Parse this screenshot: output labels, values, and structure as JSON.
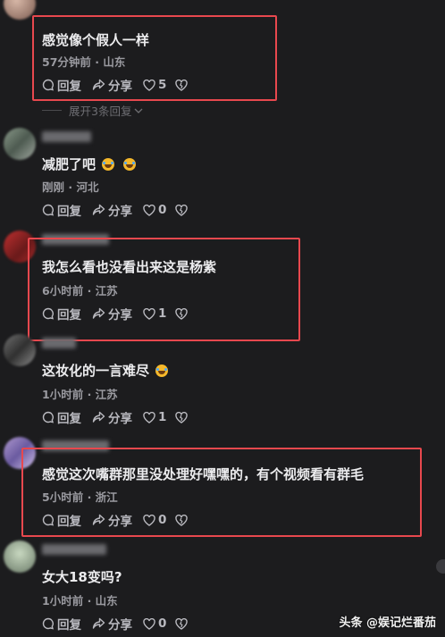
{
  "comments": [
    {
      "text": "感觉像个假人一样",
      "time": "57分钟前",
      "location": "山东",
      "reply": "回复",
      "share": "分享",
      "likes": "5",
      "emojis": 0
    },
    {
      "text": "减肥了吧",
      "time": "刚刚",
      "location": "河北",
      "reply": "回复",
      "share": "分享",
      "likes": "0",
      "emojis": 2
    },
    {
      "text": "我怎么看也没看出来这是杨紫",
      "time": "6小时前",
      "location": "江苏",
      "reply": "回复",
      "share": "分享",
      "likes": "1",
      "emojis": 0
    },
    {
      "text": "这妆化的一言难尽",
      "time": "1小时前",
      "location": "江苏",
      "reply": "回复",
      "share": "分享",
      "likes": "1",
      "emojis": 1
    },
    {
      "text": "感觉这次嘴群那里没处理好嘿嘿的，有个视频看有群毛",
      "time": "5小时前",
      "location": "浙江",
      "reply": "回复",
      "share": "分享",
      "likes": "0",
      "emojis": 0
    },
    {
      "text": "女大18变吗?",
      "time": "1小时前",
      "location": "山东",
      "reply": "回复",
      "share": "分享",
      "likes": "0",
      "emojis": 0
    }
  ],
  "expand_replies": "展开3条回复",
  "separator": "·",
  "watermark": "头条 @娱记烂番茄",
  "colors": {
    "highlight_box": "#e8484e",
    "background": "#1c1c1e"
  }
}
